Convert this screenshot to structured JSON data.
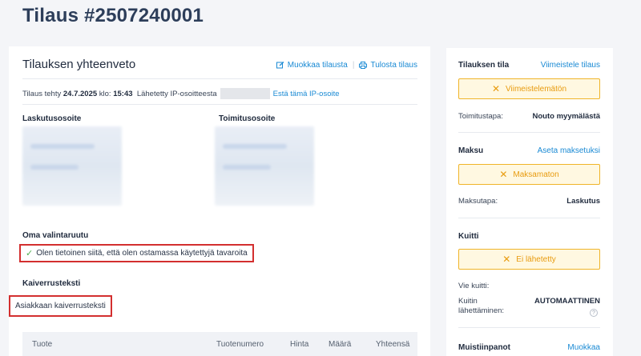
{
  "page": {
    "title": "Tilaus #2507240001"
  },
  "summary": {
    "title": "Tilauksen yhteenveto",
    "edit_label": "Muokkaa tilausta",
    "print_label": "Tulosta tilaus",
    "made_prefix": "Tilaus tehty",
    "date": "24.7.2025",
    "time_prefix": "klo:",
    "time": "15:43",
    "sent_from": "Lähetetty IP-osoitteesta",
    "block_ip": "Estä tämä IP-osoite"
  },
  "addresses": {
    "billing_label": "Laskutusosoite",
    "shipping_label": "Toimitusosoite"
  },
  "custom_checkbox": {
    "label": "Oma valintaruutu",
    "value": "Olen tietoinen siitä, että olen ostamassa käytettyjä tavaroita"
  },
  "engraving": {
    "label": "Kaiverrusteksti",
    "value": "Asiakkaan kaiverrusteksti"
  },
  "table": {
    "columns": [
      "Tuote",
      "Tuotenumero",
      "Hinta",
      "Määrä",
      "Yhteensä"
    ]
  },
  "sidebar": {
    "status": {
      "title": "Tilauksen tila",
      "action": "Viimeistele tilaus",
      "badge": "Viimeistelemätön",
      "delivery_label": "Toimitustapa:",
      "delivery_value": "Nouto myymälästä"
    },
    "payment": {
      "title": "Maksu",
      "action": "Aseta maksetuksi",
      "badge": "Maksamaton",
      "method_label": "Maksutapa:",
      "method_value": "Laskutus"
    },
    "receipt": {
      "title": "Kuitti",
      "badge": "Ei lähetetty",
      "export_label": "Vie kuitti:",
      "send_label": "Kuitin lähettäminen:",
      "send_value": "AUTOMAATTINEN"
    },
    "notes": {
      "title": "Muistiinpanot",
      "action": "Muokkaa"
    }
  },
  "colors": {
    "accent": "#1a8ad4",
    "warning": "#f0b429",
    "highlight": "#d32f2f"
  }
}
